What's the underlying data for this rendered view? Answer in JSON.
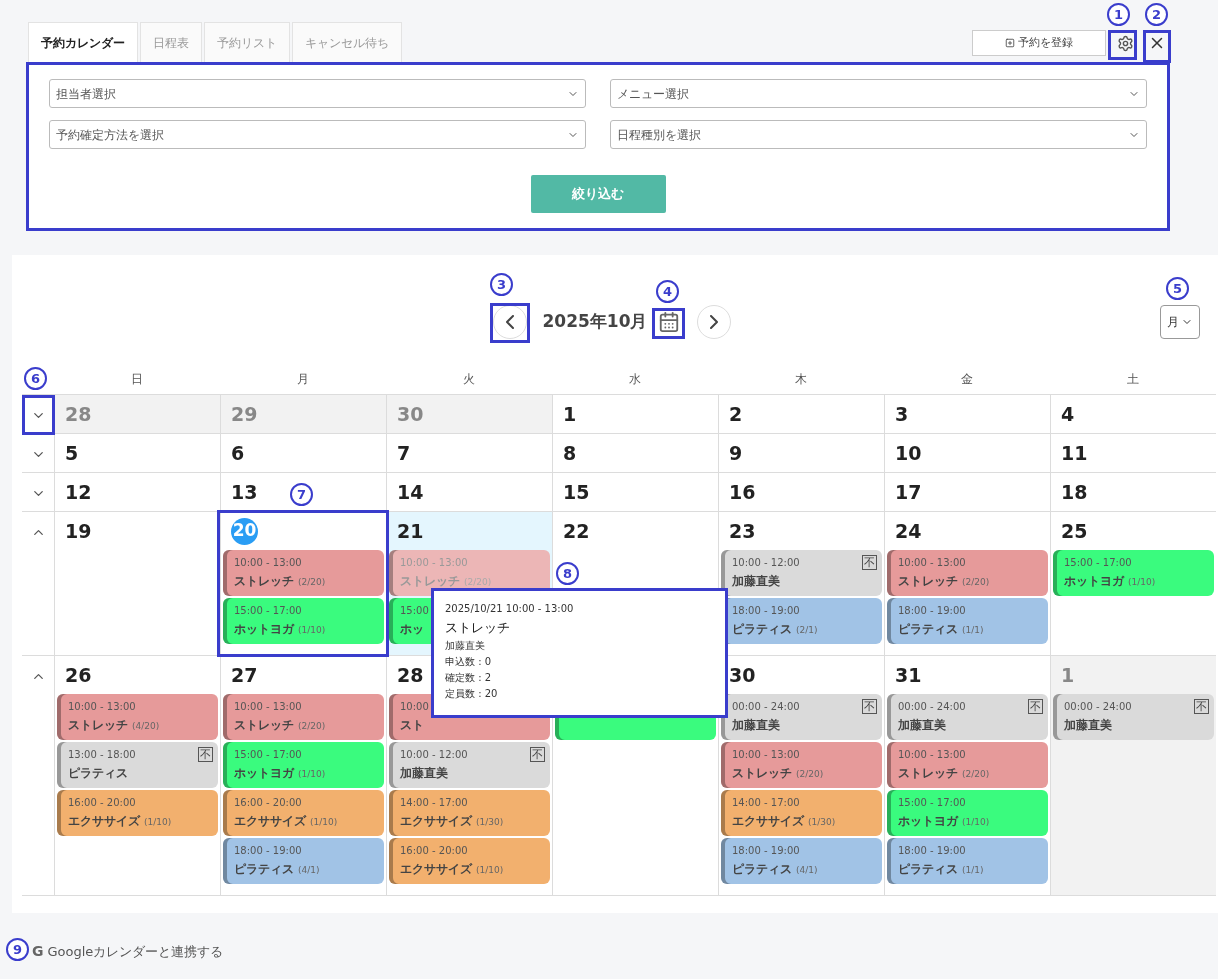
{
  "tabs": [
    {
      "label": "予約カレンダー",
      "selected": true
    },
    {
      "label": "日程表",
      "selected": false
    },
    {
      "label": "予約リスト",
      "selected": false
    },
    {
      "label": "キャンセル待ち",
      "selected": false
    }
  ],
  "register_button": {
    "label": "予約を登録"
  },
  "filters": [
    {
      "placeholder": "担当者選択"
    },
    {
      "placeholder": "メニュー選択"
    },
    {
      "placeholder": "予約確定方法を選択"
    },
    {
      "placeholder": "日程種別を選択"
    }
  ],
  "filter_button": {
    "label": "絞り込む"
  },
  "calendar": {
    "title": "2025年10月",
    "view_select": {
      "value": "月"
    },
    "weekdays": [
      "日",
      "月",
      "火",
      "水",
      "木",
      "金",
      "土"
    ],
    "weeks": [
      {
        "expanded": false,
        "days": [
          {
            "number": "28",
            "outside_month": true,
            "today": false,
            "selected": false
          },
          {
            "number": "29",
            "outside_month": true,
            "today": false,
            "selected": false
          },
          {
            "number": "30",
            "outside_month": true,
            "today": false,
            "selected": false
          },
          {
            "number": "1",
            "outside_month": false,
            "today": false,
            "selected": false
          },
          {
            "number": "2",
            "outside_month": false,
            "today": false,
            "selected": false
          },
          {
            "number": "3",
            "outside_month": false,
            "today": false,
            "selected": false
          },
          {
            "number": "4",
            "outside_month": false,
            "today": false,
            "selected": false
          }
        ]
      },
      {
        "expanded": false,
        "days": [
          {
            "number": "5",
            "outside_month": false,
            "today": false,
            "selected": false
          },
          {
            "number": "6",
            "outside_month": false,
            "today": false,
            "selected": false
          },
          {
            "number": "7",
            "outside_month": false,
            "today": false,
            "selected": false
          },
          {
            "number": "8",
            "outside_month": false,
            "today": false,
            "selected": false
          },
          {
            "number": "9",
            "outside_month": false,
            "today": false,
            "selected": false
          },
          {
            "number": "10",
            "outside_month": false,
            "today": false,
            "selected": false
          },
          {
            "number": "11",
            "outside_month": false,
            "today": false,
            "selected": false
          }
        ]
      },
      {
        "expanded": false,
        "days": [
          {
            "number": "12",
            "outside_month": false,
            "today": false,
            "selected": false
          },
          {
            "number": "13",
            "outside_month": false,
            "today": false,
            "selected": false
          },
          {
            "number": "14",
            "outside_month": false,
            "today": false,
            "selected": false
          },
          {
            "number": "15",
            "outside_month": false,
            "today": false,
            "selected": false
          },
          {
            "number": "16",
            "outside_month": false,
            "today": false,
            "selected": false
          },
          {
            "number": "17",
            "outside_month": false,
            "today": false,
            "selected": false
          },
          {
            "number": "18",
            "outside_month": false,
            "today": false,
            "selected": false
          }
        ]
      },
      {
        "expanded": true,
        "days": [
          {
            "number": "19",
            "outside_month": false,
            "today": false,
            "selected": false
          },
          {
            "number": "20",
            "outside_month": false,
            "today": true,
            "selected": false,
            "events": [
              {
                "time": "10:00 - 13:00",
                "title": "ストレッチ",
                "count": "(2/20)",
                "color": "#e69a9a",
                "dimmed": false
              },
              {
                "time": "15:00 - 17:00",
                "title": "ホットヨガ",
                "count": "(1/10)",
                "color": "#3afb7e",
                "dimmed": false
              }
            ]
          },
          {
            "number": "21",
            "outside_month": false,
            "today": false,
            "selected": true,
            "events": [
              {
                "time": "10:00 - 13:00",
                "title": "ストレッチ",
                "count": "(2/20)",
                "color": "#ecb6b6",
                "dimmed": true
              },
              {
                "time": "15:00",
                "title": "ホッ",
                "color": "#3afb7e",
                "dimmed": false
              }
            ]
          },
          {
            "number": "22",
            "outside_month": false,
            "today": false,
            "selected": false
          },
          {
            "number": "23",
            "outside_month": false,
            "today": false,
            "selected": false,
            "events": [
              {
                "time": "10:00 - 12:00",
                "title": "加藤直美",
                "badge": "不",
                "color": "#dadada",
                "dimmed": false
              },
              {
                "time": "18:00 - 19:00",
                "title": "ピラティス",
                "count": "(2/1)",
                "color": "#a1c3e6",
                "dimmed": false
              }
            ]
          },
          {
            "number": "24",
            "outside_month": false,
            "today": false,
            "selected": false,
            "events": [
              {
                "time": "10:00 - 13:00",
                "title": "ストレッチ",
                "count": "(2/20)",
                "color": "#e69a9a",
                "dimmed": false
              },
              {
                "time": "18:00 - 19:00",
                "title": "ピラティス",
                "count": "(1/1)",
                "color": "#a1c3e6",
                "dimmed": false
              }
            ]
          },
          {
            "number": "25",
            "outside_month": false,
            "today": false,
            "selected": false,
            "events": [
              {
                "time": "15:00 - 17:00",
                "title": "ホットヨガ",
                "count": "(1/10)",
                "color": "#3afb7e",
                "dimmed": false
              }
            ]
          }
        ]
      },
      {
        "expanded": true,
        "days": [
          {
            "number": "26",
            "outside_month": false,
            "today": false,
            "selected": false,
            "events": [
              {
                "time": "10:00 - 13:00",
                "title": "ストレッチ",
                "count": "(4/20)",
                "color": "#e69a9a",
                "dimmed": false
              },
              {
                "time": "13:00 - 18:00",
                "title": "ピラティス",
                "badge": "不",
                "color": "#dadada",
                "dimmed": false
              },
              {
                "time": "16:00 - 20:00",
                "title": "エクササイズ",
                "count": "(1/10)",
                "color": "#f2b06e",
                "dimmed": false
              }
            ]
          },
          {
            "number": "27",
            "outside_month": false,
            "today": false,
            "selected": false,
            "events": [
              {
                "time": "10:00 - 13:00",
                "title": "ストレッチ",
                "count": "(2/20)",
                "color": "#e69a9a",
                "dimmed": false
              },
              {
                "time": "15:00 - 17:00",
                "title": "ホットヨガ",
                "count": "(1/10)",
                "color": "#3afb7e",
                "dimmed": false
              },
              {
                "time": "16:00 - 20:00",
                "title": "エクササイズ",
                "count": "(1/10)",
                "color": "#f2b06e",
                "dimmed": false
              },
              {
                "time": "18:00 - 19:00",
                "title": "ピラティス",
                "count": "(4/1)",
                "color": "#a1c3e6",
                "dimmed": false
              }
            ]
          },
          {
            "number": "28",
            "outside_month": false,
            "today": false,
            "selected": false,
            "events": [
              {
                "time": "10:00",
                "title": "スト",
                "color": "#e69a9a",
                "dimmed": false
              },
              {
                "time": "10:00 - 12:00",
                "title": "加藤直美",
                "badge": "不",
                "color": "#dadada",
                "dimmed": false
              },
              {
                "time": "14:00 - 17:00",
                "title": "エクササイズ",
                "count": "(1/30)",
                "color": "#f2b06e",
                "dimmed": false
              },
              {
                "time": "16:00 - 20:00",
                "title": "エクササイズ",
                "count": "(1/10)",
                "color": "#f2b06e",
                "dimmed": false
              }
            ]
          },
          {
            "outside_month": false,
            "selected": false,
            "events": [
              {
                "color": "#3afb7e"
              }
            ]
          },
          {
            "number": "30",
            "outside_month": false,
            "today": false,
            "selected": false,
            "events": [
              {
                "time": "00:00 - 24:00",
                "title": "加藤直美",
                "badge": "不",
                "color": "#dadada",
                "dimmed": false
              },
              {
                "time": "10:00 - 13:00",
                "title": "ストレッチ",
                "count": "(2/20)",
                "color": "#e69a9a",
                "dimmed": false
              },
              {
                "time": "14:00 - 17:00",
                "title": "エクササイズ",
                "count": "(1/30)",
                "color": "#f2b06e",
                "dimmed": false
              },
              {
                "time": "18:00 - 19:00",
                "title": "ピラティス",
                "count": "(4/1)",
                "color": "#a1c3e6",
                "dimmed": false
              }
            ]
          },
          {
            "number": "31",
            "outside_month": false,
            "today": false,
            "selected": false,
            "events": [
              {
                "time": "00:00 - 24:00",
                "title": "加藤直美",
                "badge": "不",
                "color": "#dadada",
                "dimmed": false
              },
              {
                "time": "10:00 - 13:00",
                "title": "ストレッチ",
                "count": "(2/20)",
                "color": "#e69a9a",
                "dimmed": false
              },
              {
                "time": "15:00 - 17:00",
                "title": "ホットヨガ",
                "count": "(1/10)",
                "color": "#3afb7e",
                "dimmed": false
              },
              {
                "time": "18:00 - 19:00",
                "title": "ピラティス",
                "count": "(1/1)",
                "color": "#a1c3e6",
                "dimmed": false
              }
            ]
          },
          {
            "number": "1",
            "outside_month": true,
            "today": false,
            "selected": false,
            "events": [
              {
                "time": "00:00 - 24:00",
                "title": "加藤直美",
                "badge": "不",
                "color": "#dadada",
                "dimmed": false
              }
            ]
          }
        ]
      }
    ]
  },
  "popover": {
    "datetime": "2025/10/21 10:00 - 13:00",
    "title": "ストレッチ",
    "lines": [
      "加藤直美",
      "申込数 : 0",
      "確定数 : 2",
      "定員数 : 20"
    ]
  },
  "google_link": {
    "logo": "G",
    "label": "Googleカレンダーと連携する"
  },
  "annotations": [
    {
      "label": "1",
      "boxed": true
    },
    {
      "label": "2",
      "boxed": true
    },
    {
      "label": "3",
      "boxed": true
    },
    {
      "label": "4",
      "boxed": true
    },
    {
      "label": "5",
      "boxed": false
    },
    {
      "label": "6",
      "boxed": true
    },
    {
      "label": "7",
      "boxed": true
    },
    {
      "label": "8",
      "boxed": true
    },
    {
      "label": "9",
      "boxed": false
    }
  ]
}
